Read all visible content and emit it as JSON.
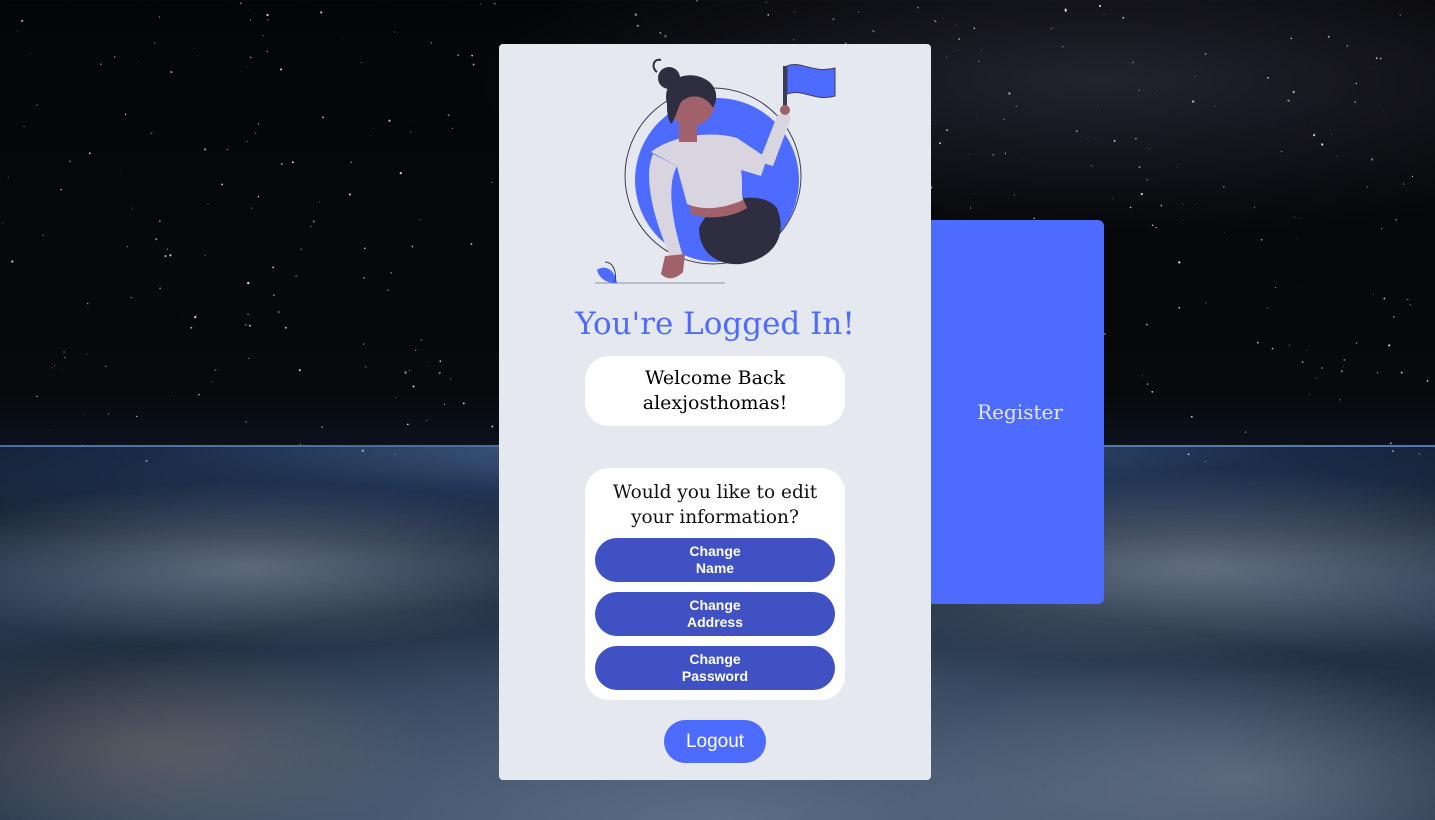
{
  "title": "You're Logged In!",
  "welcome": {
    "line1": "Welcome Back",
    "line2": "alexjosthomas!"
  },
  "edit": {
    "question_line1": "Would you like to edit",
    "question_line2": "your information?",
    "buttons": [
      {
        "line1": "Change",
        "line2": "Name"
      },
      {
        "line1": "Change",
        "line2": "Address"
      },
      {
        "line1": "Change",
        "line2": "Password"
      }
    ]
  },
  "logout_label": "Logout",
  "register_label": "Register",
  "colors": {
    "accent": "#4d6bfe",
    "button_dark": "#3f51c3",
    "card_bg": "#e5e8ef"
  },
  "icons": {
    "illustration": "woman-with-flag-illustration"
  }
}
